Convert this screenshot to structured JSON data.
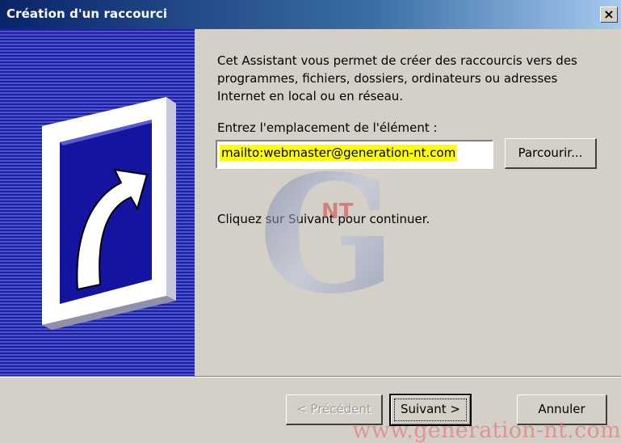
{
  "window": {
    "title": "Création d'un raccourci",
    "close_label": "×"
  },
  "wizard": {
    "description": "Cet Assistant vous permet de créer des raccourcis vers des programmes, fichiers, dossiers, ordinateurs ou adresses Internet en local ou en réseau.",
    "location_label": "Entrez l'emplacement de l'élément :",
    "location_value": "mailto:webmaster@generation-nt.com",
    "browse_label": "Parcourir...",
    "hint": "Cliquez sur Suivant pour continuer."
  },
  "footer": {
    "back_label": "< Précédent",
    "next_label": "Suivant >",
    "cancel_label": "Annuler"
  },
  "watermark": {
    "logo_letter": "G",
    "logo_badge": "NT",
    "url": "www.generation-nt.com"
  },
  "colors": {
    "titlebar": "#0a246a",
    "side_panel": "#1e1ea8",
    "highlight": "#ffff00",
    "dialog_bg": "#d4d0c8"
  }
}
